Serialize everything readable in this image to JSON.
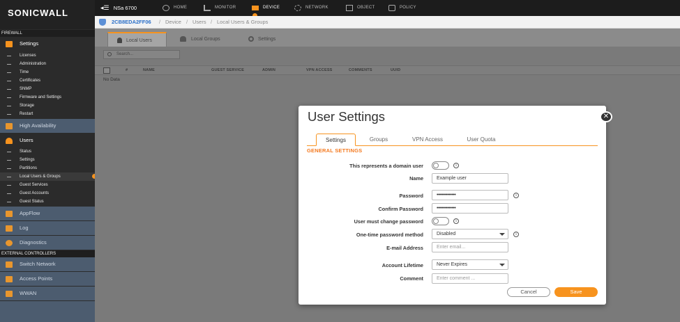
{
  "brand": {
    "logo_text": "SONICWALL",
    "accent": "#f7931e"
  },
  "topbar": {
    "menu_icon": "hamburger-back-icon",
    "device_name": "NSa 6700",
    "nav": [
      {
        "label": "HOME",
        "icon": "gauge-icon"
      },
      {
        "label": "MONITOR",
        "icon": "chart-icon"
      },
      {
        "label": "DEVICE",
        "icon": "device-icon"
      },
      {
        "label": "NETWORK",
        "icon": "network-icon"
      },
      {
        "label": "OBJECT",
        "icon": "object-icon"
      },
      {
        "label": "POLICY",
        "icon": "policy-icon"
      }
    ]
  },
  "breadcrumb": {
    "serial": "2CB8EDA2FF06",
    "items": [
      "Device",
      "Users",
      "Local Users & Groups"
    ]
  },
  "sidebar": {
    "firewall_header": "FIREWALL",
    "settings_group": "Settings",
    "settings_items": [
      "Licenses",
      "Administration",
      "Time",
      "Certificates",
      "SNMP",
      "Firmware and Settings",
      "Storage",
      "Restart"
    ],
    "high_availability": "High Availability",
    "users_group": "Users",
    "users_items": [
      "Status",
      "Settings",
      "Partitions",
      "Local Users & Groups",
      "Guest Services",
      "Guest Accounts",
      "Guest Status"
    ],
    "appflow": "AppFlow",
    "log": "Log",
    "diagnostics": "Diagnostics",
    "external_header": "EXTERNAL CONTROLLERS",
    "switch_network": "Switch Network",
    "access_points": "Access Points",
    "wwan": "WWAN"
  },
  "page_tabs": [
    "Local Users",
    "Local Groups",
    "Settings"
  ],
  "search": {
    "placeholder": "Search..."
  },
  "table": {
    "columns": [
      "#",
      "NAME",
      "GUEST SERVICE",
      "ADMIN",
      "VPN ACCESS",
      "COMMENTS",
      "UUID"
    ],
    "empty_text": "No Data"
  },
  "modal": {
    "title": "User Settings",
    "tabs": [
      "Settings",
      "Groups",
      "VPN Access",
      "User Quota"
    ],
    "section": "GENERAL SETTINGS",
    "fields": {
      "domain_user_label": "This represents a domain user",
      "name_label": "Name",
      "name_value": "Example user",
      "password_label": "Password",
      "password_value": "••••••••••••••",
      "confirm_label": "Confirm Password",
      "confirm_value": "••••••••••••••",
      "must_change_label": "User must change password",
      "otp_label": "One-time password method",
      "otp_value": "Disabled",
      "email_label": "E-mail Address",
      "email_placeholder": "Enter email...",
      "lifetime_label": "Account Lifetime",
      "lifetime_value": "Never Expires",
      "comment_label": "Comment",
      "comment_placeholder": "Enter comment ..."
    },
    "cancel_label": "Cancel",
    "save_label": "Save",
    "close_glyph": "✕"
  }
}
